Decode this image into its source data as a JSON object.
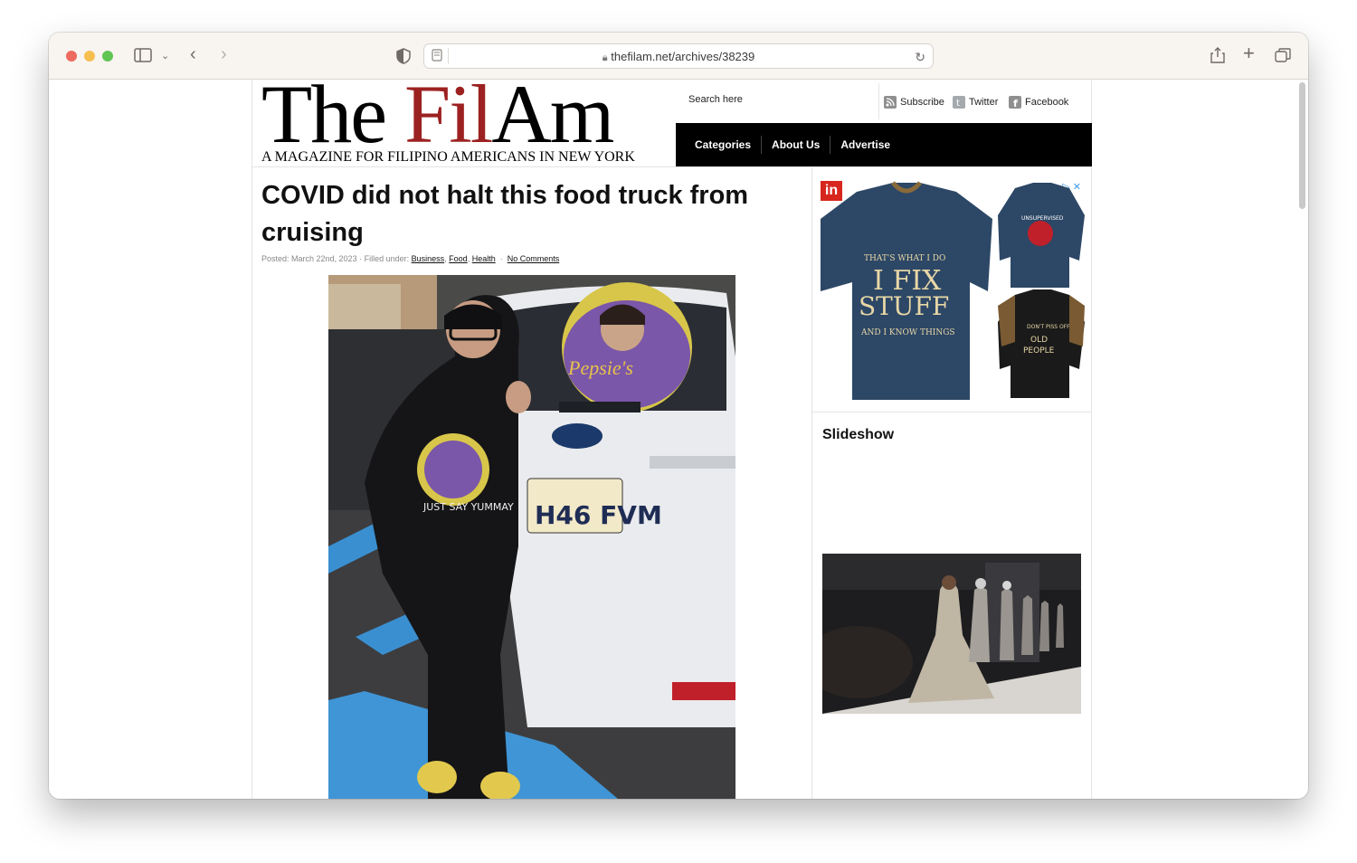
{
  "browser": {
    "url": "thefilam.net/archives/38239"
  },
  "site": {
    "logo_part1": "The ",
    "logo_part2": "Fil",
    "logo_part3": "Am",
    "tagline": "A MAGAZINE FOR FILIPINO AMERICANS IN NEW YORK",
    "search_placeholder": "Search here",
    "social": {
      "subscribe": "Subscribe",
      "twitter": "Twitter",
      "facebook": "Facebook"
    },
    "nav": [
      "Categories",
      "About Us",
      "Advertise"
    ]
  },
  "post": {
    "title": "COVID did not halt this food truck from cruising",
    "meta_posted": "Posted: March 22nd, 2023 · Filled under:",
    "categories": [
      "Business",
      "Food",
      "Health"
    ],
    "comments": "No Comments"
  },
  "ad": {
    "badge": "in",
    "close": "▷ ✕",
    "shirt1_text": "THAT'S WHAT I DO I FIX STUFF AND I KNOW THINGS"
  },
  "sidebar": {
    "slideshow_heading": "Slideshow"
  },
  "colors": {
    "brand_red": "#9c2121",
    "nav_bg": "#000000"
  }
}
